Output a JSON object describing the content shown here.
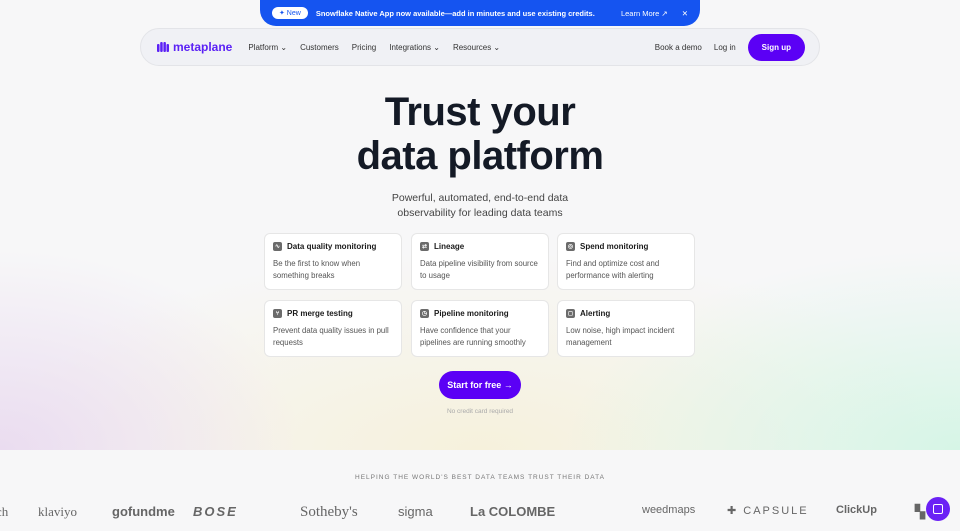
{
  "banner": {
    "badge": "✦ New",
    "message": "Snowflake Native App now available—add in minutes and use existing credits.",
    "link": "Learn More ↗",
    "close": "✕"
  },
  "nav": {
    "logo": "metaplane",
    "items": [
      "Platform ⌄",
      "Customers",
      "Pricing",
      "Integrations ⌄",
      "Resources ⌄"
    ],
    "book": "Book a demo",
    "login": "Log in",
    "signup": "Sign up"
  },
  "hero": {
    "title_line1": "Trust your",
    "title_line2": "data platform",
    "subtitle_line1": "Powerful, automated, end-to-end data",
    "subtitle_line2": "observability for leading data teams"
  },
  "features": [
    {
      "title": "Data quality monitoring",
      "desc": "Be the first to know when something breaks",
      "icon": "activity-icon"
    },
    {
      "title": "Lineage",
      "desc": "Data pipeline visibility from source to usage",
      "icon": "lineage-icon"
    },
    {
      "title": "Spend monitoring",
      "desc": "Find and optimize cost and performance with alerting",
      "icon": "coin-icon"
    },
    {
      "title": "PR merge testing",
      "desc": "Prevent data quality issues in pull requests",
      "icon": "git-merge-icon"
    },
    {
      "title": "Pipeline monitoring",
      "desc": "Have confidence that your pipelines are running smoothly",
      "icon": "clock-icon"
    },
    {
      "title": "Alerting",
      "desc": "Low noise, high impact incident management",
      "icon": "bell-icon"
    }
  ],
  "cta": {
    "label": "Start for free →",
    "note": "No credit card required"
  },
  "trust": {
    "label": "HELPING THE WORLD'S BEST DATA TEAMS TRUST THEIR DATA",
    "logos": [
      "ch",
      "klaviyo",
      "gofundme",
      "BOSE",
      "Sotheby's",
      "sigma",
      "La COLOMBE",
      "weedmaps",
      "✚ CAPSULE",
      "ClickUp",
      "▚ hl"
    ]
  },
  "colors": {
    "banner": "#1554f0",
    "accent": "#5b00f5"
  }
}
